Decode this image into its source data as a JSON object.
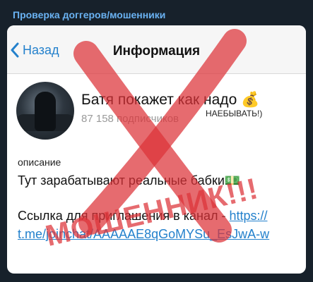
{
  "post": {
    "channel_name": "Проверка доггеров/мошенники"
  },
  "nav": {
    "back_label": "Назад",
    "title": "Информация"
  },
  "channel": {
    "title": "Батя покажет как надо 💰",
    "subscribers": "87 158 подписчиков",
    "subscribers_note": "НАЕБЫВАТЬ!)"
  },
  "description": {
    "label": "описание",
    "text": "Тут зарабатывают реальные бабки💵"
  },
  "invite": {
    "prefix": "Ссылка для приглашения в канал - ",
    "link_part1": "https://",
    "link_part2": "t.me/joinchat/AAAAAE8qGoMYSu_EsJwA-w"
  },
  "overlay": {
    "stamp_text": "МОШЕННИК!!!",
    "cross_color": "#e0383e"
  },
  "icons": {
    "back": "chevron-left-icon"
  },
  "colors": {
    "accent": "#2481cc",
    "header_bg": "#17212b",
    "channel_name": "#6ab2f2"
  }
}
